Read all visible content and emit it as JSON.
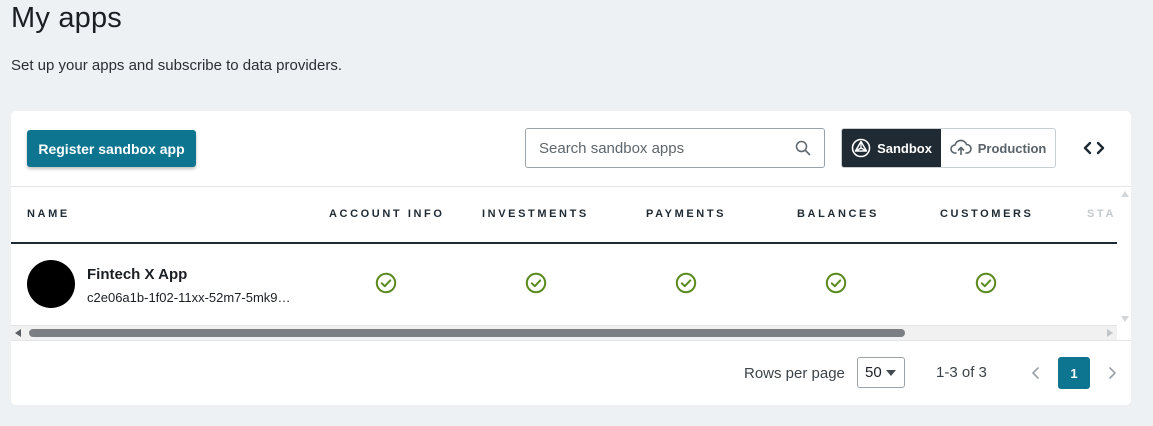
{
  "page": {
    "title": "My apps",
    "subtitle": "Set up your apps and subscribe to data providers."
  },
  "toolbar": {
    "register_label": "Register sandbox app",
    "search_placeholder": "Search sandbox apps",
    "env_sandbox": "Sandbox",
    "env_production": "Production",
    "env_selected": "Sandbox"
  },
  "table": {
    "columns": [
      "NAME",
      "ACCOUNT INFO",
      "INVESTMENTS",
      "PAYMENTS",
      "BALANCES",
      "CUSTOMERS",
      "STA"
    ],
    "rows": [
      {
        "name": "Fintech X App",
        "id": "c2e06a1b-1f02-11xx-52m7-5mk9…",
        "account_info": "check-circle-icon",
        "investments": "check-circle-icon",
        "payments": "check-circle-icon",
        "balances": "check-circle-icon",
        "customers": "check-circle-icon"
      }
    ]
  },
  "pagination": {
    "rows_per_page_label": "Rows per page",
    "rows_per_page_value": "50",
    "range_label": "1-3 of 3",
    "current_page": "1"
  },
  "colors": {
    "accent": "#0d7590",
    "dark": "#1f2a33",
    "check_green": "#5a8a1e",
    "background": "#edf1f3"
  }
}
